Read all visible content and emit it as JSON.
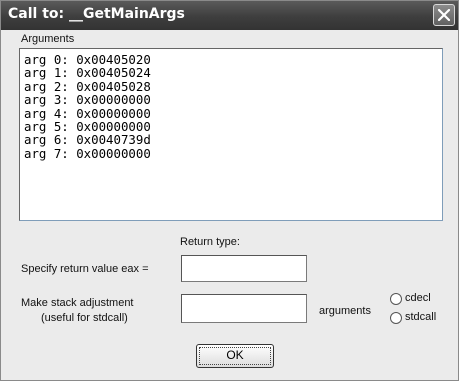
{
  "dialog": {
    "title": "Call to: __GetMainArgs"
  },
  "arguments": {
    "label": "Arguments",
    "lines": [
      "arg 0: 0x00405020",
      "arg 1: 0x00405024",
      "arg 2: 0x00405028",
      "arg 3: 0x00000000",
      "arg 4: 0x00000000",
      "arg 5: 0x00000000",
      "arg 6: 0x0040739d",
      "arg 7: 0x00000000"
    ]
  },
  "return_type": {
    "label": "Return type:",
    "eax_label": "Specify return value eax =",
    "eax_value": ""
  },
  "stack": {
    "label_line1": "Make stack adjustment",
    "label_line2": "(useful for stdcall)",
    "value": "",
    "suffix": "arguments"
  },
  "convention": {
    "options": [
      "cdecl",
      "stdcall"
    ],
    "selected": null
  },
  "buttons": {
    "ok": "OK"
  },
  "icons": {
    "close": "close-icon"
  }
}
